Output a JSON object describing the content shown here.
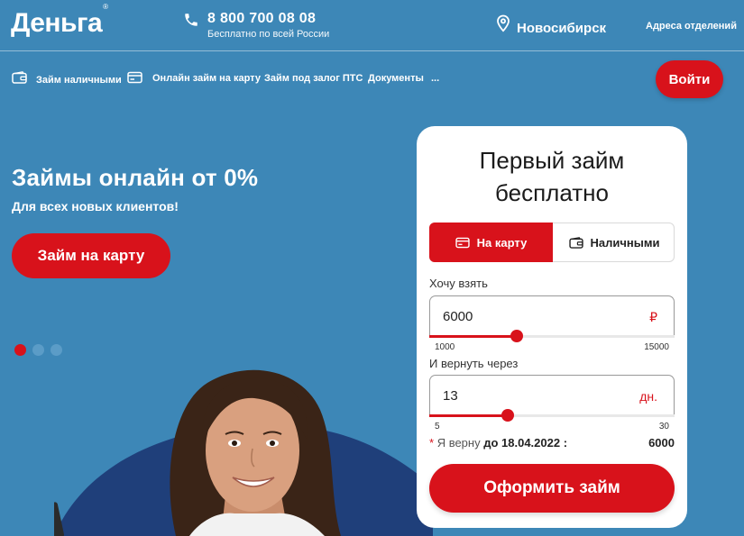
{
  "header": {
    "logo": "Деньга",
    "logo_mark": "®",
    "phone": "8 800 700 08 08",
    "phone_subtitle": "Бесплатно по всей России",
    "city": "Новосибирск",
    "branches_link": "Адреса отделений",
    "icons": {
      "phone": "phone-icon",
      "location": "location-pin-icon"
    }
  },
  "nav": {
    "items": [
      {
        "label": "Займ наличными",
        "icon": "wallet-icon"
      },
      {
        "label": "Онлайн займ на карту",
        "icon": "credit-card-icon"
      },
      {
        "label": "Займ под залог ПТС"
      },
      {
        "label": "Документы"
      },
      {
        "label": "..."
      }
    ],
    "login_label": "Войти"
  },
  "hero": {
    "title": "Займы онлайн от 0%",
    "subtitle": "Для всех новых клиентов!",
    "cta_label": "Займ на карту",
    "slides_total": 3,
    "slide_active": 1
  },
  "calculator": {
    "title_line1": "Первый займ",
    "title_line2": "бесплатно",
    "tabs": [
      {
        "label": "На карту",
        "icon": "credit-card-icon",
        "active": true
      },
      {
        "label": "Наличными",
        "icon": "wallet-icon",
        "active": false
      }
    ],
    "amount": {
      "label": "Хочу взять",
      "value": "6000",
      "unit": "₽",
      "min": "1000",
      "max": "15000",
      "slider_fraction": 0.357
    },
    "term": {
      "label": "И вернуть через",
      "value": "13",
      "unit": "дн.",
      "min": "5",
      "max": "30",
      "slider_fraction": 0.32
    },
    "summary": {
      "star": "*",
      "prefix": "Я верну",
      "date_text": "до 18.04.2022 :",
      "amount": "6000"
    },
    "submit_label": "Оформить займ"
  },
  "colors": {
    "background": "#3d87b7",
    "accent": "#d8121b",
    "card": "#ffffff",
    "hero_arc": "#1f3f7a"
  }
}
